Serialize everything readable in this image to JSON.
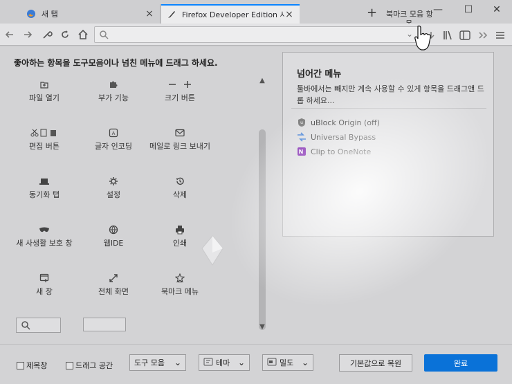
{
  "tabs": [
    {
      "label": "새 탭",
      "active": false
    },
    {
      "label": "Firefox Developer Edition 사용",
      "active": true
    }
  ],
  "window": {
    "bookmark_drop_line1": "북마크 모음 항",
    "bookmark_drop_line2": "목"
  },
  "customize": {
    "instructions": "좋아하는 항목을 도구모음이나 넘친 메뉴에 드래그 하세요.",
    "palette": [
      {
        "label": "파일 열기",
        "icon": "folder-icon"
      },
      {
        "label": "부가 기능",
        "icon": "puzzle-icon"
      },
      {
        "label": "크기 버튼",
        "icon": "zoom-controls-icon"
      },
      {
        "label": "편집 버튼",
        "icon": "edit-controls-icon"
      },
      {
        "label": "글자 인코딩",
        "icon": "text-encoding-icon"
      },
      {
        "label": "메일로 링크 보내기",
        "icon": "mail-icon"
      },
      {
        "label": "동기화 탭",
        "icon": "synced-tabs-icon"
      },
      {
        "label": "설정",
        "icon": "gear-icon"
      },
      {
        "label": "삭제",
        "icon": "forget-history-icon"
      },
      {
        "label": "새 사생활 보호 창",
        "icon": "private-window-icon"
      },
      {
        "label": "웹IDE",
        "icon": "webide-icon"
      },
      {
        "label": "인쇄",
        "icon": "print-icon"
      },
      {
        "label": "새 창",
        "icon": "new-window-icon"
      },
      {
        "label": "전체 화면",
        "icon": "fullscreen-icon"
      },
      {
        "label": "북마크 메뉴",
        "icon": "bookmark-menu-icon"
      }
    ]
  },
  "overflow": {
    "title": "넘어간 메뉴",
    "description": "툴바에서는 빼지만 계속 사용할 수 있게 항목을 드래그앤 드롭 하세요...",
    "items": [
      {
        "label": "uBlock Origin (off)",
        "icon": "ublock-icon"
      },
      {
        "label": "Universal Bypass",
        "icon": "bypass-icon"
      },
      {
        "label": "Clip to OneNote",
        "icon": "onenote-icon"
      }
    ]
  },
  "footer": {
    "titlebar_label": "제목창",
    "dragspace_label": "드래그 공간",
    "toolbars_label": "도구 모음",
    "themes_label": "테마",
    "density_label": "밀도",
    "restore_label": "기본값으로 복원",
    "done_label": "완료"
  },
  "colors": {
    "accent": "#0a84ff",
    "done_button": "#0a72d8"
  }
}
